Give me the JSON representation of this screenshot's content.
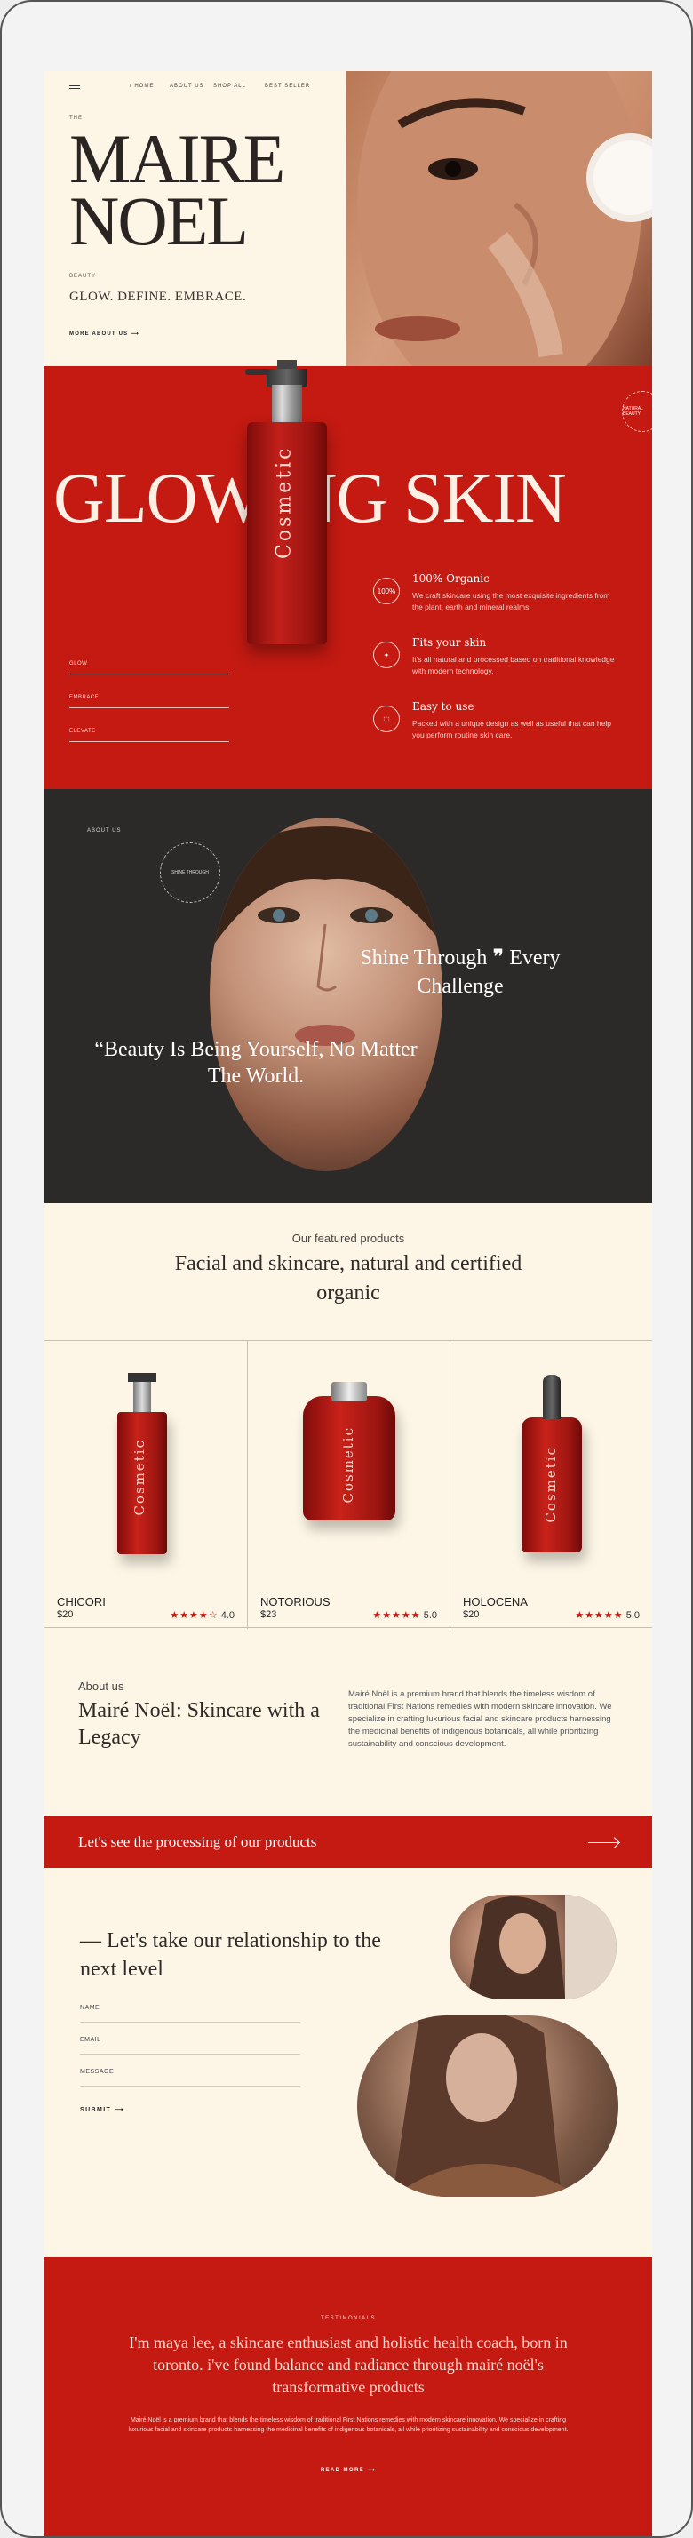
{
  "nav": {
    "items": [
      "/ HOME",
      "ABOUT US",
      "SHOP ALL",
      "BEST SELLER"
    ]
  },
  "hero": {
    "overline": "THE",
    "brand_line1": "MAIRE",
    "brand_line2": "NOEL",
    "small_label": "BEAUTY",
    "tagline": "GLOW. DEFINE. EMBRACE.",
    "more_about": "MORE ABOUT US",
    "bottle_text": "Cosmetic"
  },
  "glowing": {
    "headline": "GLOWING SKIN",
    "badge_text": "NATURAL BEAUTY",
    "inputs": [
      "GLOW",
      "EMBRACE",
      "ELEVATE"
    ],
    "features": [
      {
        "icon": "organic-icon",
        "icon_text": "100%",
        "title": "100% Organic",
        "text": "We craft skincare using the most exquisite ingredients from the plant, earth and mineral realms."
      },
      {
        "icon": "sparkle-icon",
        "icon_text": "✦",
        "title": "Fits your skin",
        "text": "It's all natural and processed based on traditional knowledge with modern technology."
      },
      {
        "icon": "bottle-icon",
        "icon_text": "⬚",
        "title": "Easy to use",
        "text": "Packed with a unique design as well as useful that can help you perform routine skin care."
      }
    ]
  },
  "about_dark": {
    "label": "ABOUT US",
    "badge_text": "SHINE THROUGH",
    "quote_main": "“Beauty Is Being Yourself, No Matter The World.",
    "quote_side": "Shine Through ❞ Every Challenge"
  },
  "featured": {
    "subtitle": "Our featured products",
    "heading": "Facial and skincare, natural and certified organic",
    "products": [
      {
        "name": "CHICORI",
        "price": "$20",
        "stars": "★★★★☆",
        "rating": "4.0",
        "label": "Cosmetic"
      },
      {
        "name": "NOTORIOUS",
        "price": "$23",
        "stars": "★★★★★",
        "rating": "5.0",
        "label": "Cosmetic"
      },
      {
        "name": "HOLOCENA",
        "price": "$20",
        "stars": "★★★★★",
        "rating": "5.0",
        "label": "Cosmetic"
      }
    ]
  },
  "about": {
    "subtitle": "About us",
    "heading": "Mairé Noël: Skincare with a Legacy",
    "paragraph": "Mairé Noël is a premium brand that blends the timeless wisdom of traditional First Nations remedies with modern skincare innovation. We specialize in crafting luxurious facial and skincare products harnessing the medicinal benefits of indigenous botanicals, all while prioritizing sustainability and conscious development."
  },
  "banner": {
    "text": "Let's see the processing of our products"
  },
  "contact": {
    "heading": "— Let's take our relationship to the next level",
    "fields": [
      "NAME",
      "EMAIL",
      "MESSAGE"
    ],
    "submit": "SUBMIT"
  },
  "testimonials": {
    "label": "TESTIMONIALS",
    "quote": "I'm maya lee, a skincare enthusiast and holistic health coach, born in toronto. i've found balance and radiance through mairé noël's transformative products",
    "paragraph": "Mairé Noël is a premium brand that blends the timeless wisdom of traditional First Nations remedies with modern skincare innovation. We specialize in crafting luxurious facial and skincare products harnessing the medicinal benefits of indigenous botanicals, all while prioritizing sustainability and conscious development.",
    "read_more": "READ MORE"
  },
  "colors": {
    "accent": "#c41a12",
    "cream": "#fdf6e6",
    "dark": "#2c2a28"
  }
}
